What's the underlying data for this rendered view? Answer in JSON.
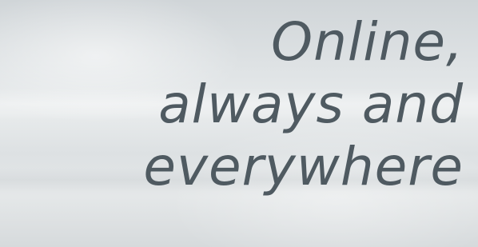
{
  "hero": {
    "headline_lines": [
      "Online,",
      "always and",
      "everywhere"
    ],
    "text_color": "#4f5a61",
    "background_color": "#e2e6e8"
  }
}
